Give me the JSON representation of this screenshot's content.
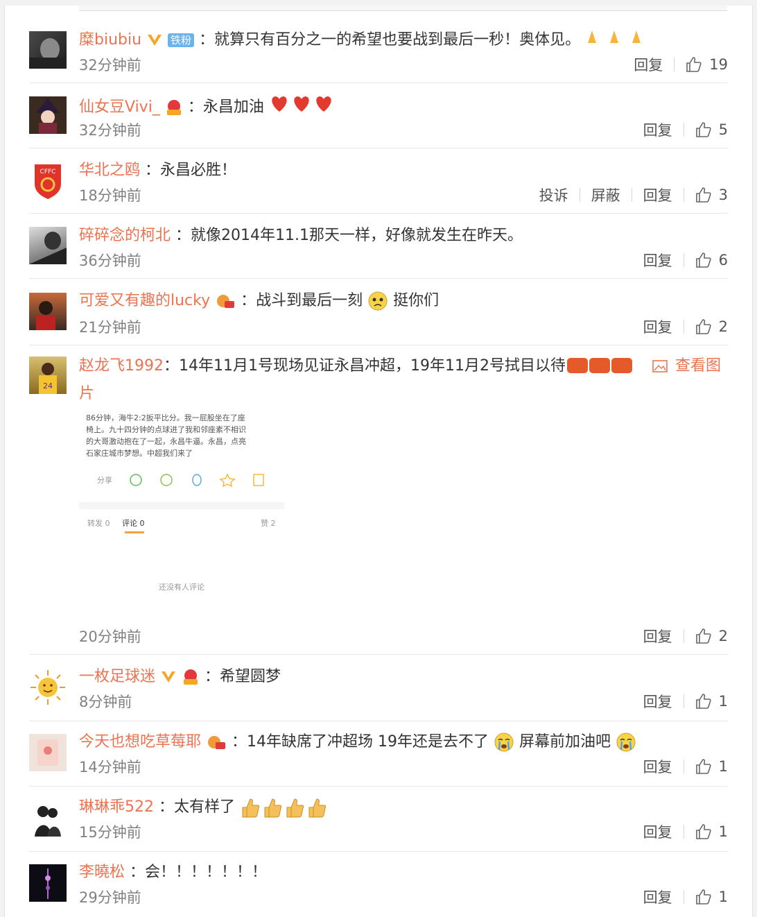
{
  "comments": [
    {
      "user": "糜biubiu",
      "tag": "铁粉",
      "text": "：就算只有百分之一的希望也要战到最后一秒！奥体见。",
      "time": "32分钟前",
      "reply": "回复",
      "likes": "19"
    },
    {
      "user": "仙女豆Vivi_",
      "text": "：永昌加油",
      "time": "32分钟前",
      "reply": "回复",
      "likes": "5"
    },
    {
      "user": "华北之鸥",
      "text": "：永昌必胜！",
      "time": "18分钟前",
      "report": "投诉",
      "block": "屏蔽",
      "reply": "回复",
      "likes": "3"
    },
    {
      "user": "碎碎念的柯北",
      "text": "：就像2014年11.1那天一样，好像就发生在昨天。",
      "time": "36分钟前",
      "reply": "回复",
      "likes": "6"
    },
    {
      "user": "可爱又有趣的lucky",
      "text": "：战斗到最后一刻",
      "text2": "挺你们",
      "time": "21分钟前",
      "reply": "回复",
      "likes": "2"
    },
    {
      "user": "赵龙飞1992",
      "text": "：14年11月1号现场见证永昌冲超，19年11月2号拭目以待",
      "view": "查看图片",
      "time": "20分钟前",
      "reply": "回复",
      "likes": "2",
      "shot": {
        "line1": "86分钟，海牛2:2扳平比分。我一屁股坐在了座",
        "line2": "椅上。九十四分钟的点球进了我和邻座素不相识",
        "line3": "的大哥激动抱在了一起，永昌牛逼。永昌，点亮",
        "line4": "石家庄城市梦想。中超我们来了",
        "share": "分享",
        "tab1": "转发 0",
        "tab2": "评论 0",
        "tab3": "赞 2",
        "empty": "还没有人评论"
      }
    },
    {
      "user": "一枚足球迷",
      "text": "：希望圆梦",
      "time": "8分钟前",
      "reply": "回复",
      "likes": "1"
    },
    {
      "user": "今天也想吃草莓耶",
      "text": "：14年缺席了冲超场 19年还是去不了",
      "text2": "屏幕前加油吧",
      "time": "14分钟前",
      "reply": "回复",
      "likes": "1"
    },
    {
      "user": "琳琳乖522",
      "text": "：太有样了",
      "time": "15分钟前",
      "reply": "回复",
      "likes": "1"
    },
    {
      "user": "李曉松",
      "text": "：会！！！！！！！",
      "time": "29分钟前",
      "reply": "回复",
      "likes": "1"
    }
  ],
  "badge_vip": "VIP6",
  "colors": {
    "username": "#eb7350",
    "body": "#333333",
    "time": "#808080",
    "vip": "#f5a623",
    "badge": "#4e9fe8"
  }
}
